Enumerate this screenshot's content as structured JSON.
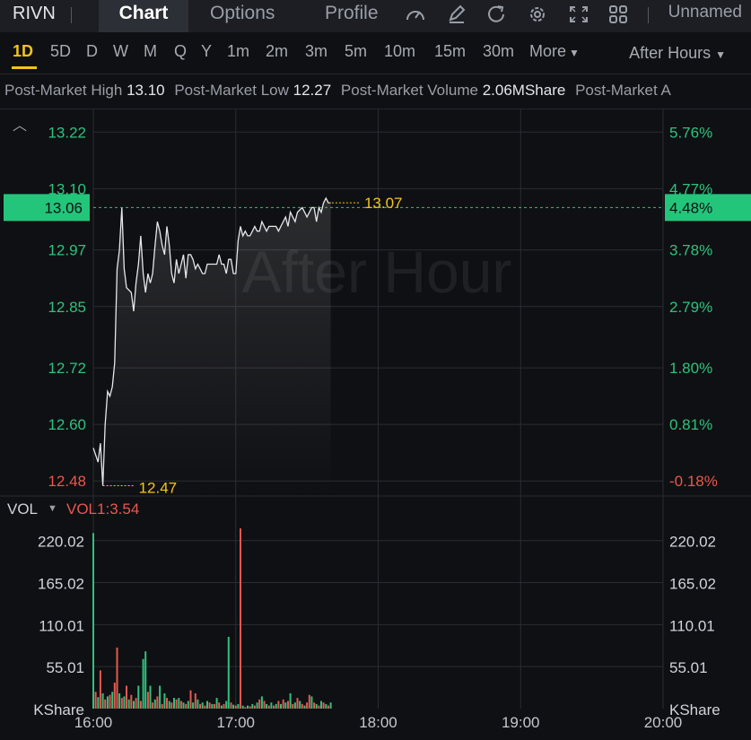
{
  "toolbar": {
    "ticker": "RIVN",
    "tabs": [
      "Chart",
      "Options",
      "Profile"
    ],
    "active_tab": "Chart",
    "layout_name": "Unnamed"
  },
  "timeframes": {
    "items": [
      "1D",
      "5D",
      "D",
      "W",
      "M",
      "Q",
      "Y",
      "1m",
      "2m",
      "3m",
      "5m",
      "10m",
      "15m",
      "30m"
    ],
    "active": "1D",
    "more_label": "More",
    "session_label": "After Hours"
  },
  "info": {
    "high_label": "Post-Market High",
    "high_value": "13.10",
    "low_label": "Post-Market Low",
    "low_value": "12.27",
    "volume_label": "Post-Market Volume",
    "volume_value": "2.06MShare",
    "truncated_label": "Post-Market A"
  },
  "colors": {
    "up": "#2ec27e",
    "down": "#e8574f",
    "current_price_bg": "#23c57a",
    "marker": "#f5c518",
    "line": "#e6e7ea",
    "grid": "#2a2c32"
  },
  "watermark": "After Hour",
  "chart_data": [
    {
      "type": "line",
      "xlim": [
        "16:00",
        "20:00"
      ],
      "x_ticks": [
        "16:00",
        "17:00",
        "18:00",
        "19:00",
        "20:00"
      ],
      "ylim": [
        12.45,
        13.27
      ],
      "y_ticks": [
        13.22,
        13.1,
        12.97,
        12.85,
        12.72,
        12.6,
        12.48
      ],
      "y_tick_labels": [
        "13.22",
        "13.10",
        "12.97",
        "12.85",
        "12.72",
        "12.60",
        "12.48"
      ],
      "right_ticks_pct": [
        "5.76%",
        "4.77%",
        "3.78%",
        "2.79%",
        "1.80%",
        "0.81%",
        "-0.18%"
      ],
      "current_price": "13.06",
      "current_pct": "4.48%",
      "high_marker": {
        "x": "17:39",
        "value": "13.07"
      },
      "low_marker": {
        "x": "16:04",
        "value": "12.47"
      },
      "series": [
        {
          "x": [
            "16:00",
            "16:02",
            "16:03",
            "16:04",
            "16:05",
            "16:06",
            "16:07",
            "16:08",
            "16:09",
            "16:10",
            "16:11",
            "16:12",
            "16:13",
            "16:14",
            "16:16",
            "16:17",
            "16:18",
            "16:19",
            "16:20",
            "16:21",
            "16:22",
            "16:23",
            "16:24",
            "16:25",
            "16:26",
            "16:27",
            "16:28",
            "16:29",
            "16:30",
            "16:31",
            "16:32",
            "16:33",
            "16:34",
            "16:35",
            "16:36",
            "16:37",
            "16:38",
            "16:39",
            "16:40",
            "16:41",
            "16:42",
            "16:43",
            "16:44",
            "16:45",
            "16:46",
            "16:47",
            "16:48",
            "16:50",
            "16:51",
            "16:52",
            "16:53",
            "16:54",
            "16:55",
            "16:56",
            "16:57",
            "16:58",
            "16:59",
            "17:00",
            "17:01",
            "17:02",
            "17:03",
            "17:04",
            "17:05",
            "17:06",
            "17:07",
            "17:08",
            "17:09",
            "17:10",
            "17:11",
            "17:12",
            "17:13",
            "17:14",
            "17:16",
            "17:17",
            "17:18",
            "17:19",
            "17:21",
            "17:22",
            "17:23",
            "17:24",
            "17:25",
            "17:26",
            "17:28",
            "17:29",
            "17:30",
            "17:31",
            "17:32",
            "17:33",
            "17:34",
            "17:35",
            "17:36",
            "17:37",
            "17:38",
            "17:39",
            "17:40"
          ],
          "y": [
            12.55,
            12.52,
            12.56,
            12.47,
            12.6,
            12.67,
            12.66,
            12.68,
            12.73,
            12.93,
            12.97,
            13.06,
            12.93,
            12.89,
            12.88,
            12.84,
            12.9,
            12.94,
            13.0,
            12.92,
            12.88,
            12.92,
            12.9,
            12.92,
            12.98,
            13.03,
            13.01,
            12.98,
            12.96,
            13.02,
            12.98,
            12.92,
            12.9,
            12.95,
            12.92,
            12.94,
            12.96,
            12.91,
            12.96,
            12.96,
            12.95,
            12.93,
            12.94,
            12.93,
            12.92,
            12.92,
            12.94,
            12.94,
            12.94,
            12.94,
            12.96,
            12.94,
            12.94,
            12.92,
            12.95,
            12.95,
            12.92,
            12.92,
            12.99,
            13.02,
            13.0,
            13.01,
            13.0,
            13.0,
            13.01,
            13.02,
            13.01,
            13.01,
            13.03,
            13.02,
            13.01,
            13.02,
            13.02,
            13.02,
            13.01,
            13.02,
            13.04,
            13.02,
            13.05,
            13.04,
            13.03,
            13.05,
            13.06,
            13.05,
            13.04,
            13.05,
            13.06,
            13.06,
            13.03,
            13.06,
            13.05,
            13.07,
            13.08,
            13.07,
            13.07
          ]
        }
      ]
    },
    {
      "type": "bar",
      "title": "VOL",
      "indicator_label": "VOL1:3.54",
      "unit_label": "KShare",
      "ylim": [
        0,
        235
      ],
      "y_ticks": [
        55.01,
        110.01,
        165.02,
        220.02
      ],
      "y_tick_labels": [
        "55.01",
        "110.01",
        "165.02",
        "220.02"
      ],
      "xlim": [
        "16:00",
        "20:00"
      ],
      "x": [
        "16:00",
        "16:01",
        "16:02",
        "16:03",
        "16:04",
        "16:05",
        "16:06",
        "16:07",
        "16:08",
        "16:09",
        "16:10",
        "16:11",
        "16:12",
        "16:13",
        "16:14",
        "16:15",
        "16:16",
        "16:17",
        "16:18",
        "16:19",
        "16:20",
        "16:21",
        "16:22",
        "16:23",
        "16:24",
        "16:25",
        "16:26",
        "16:27",
        "16:28",
        "16:29",
        "16:30",
        "16:31",
        "16:32",
        "16:33",
        "16:34",
        "16:35",
        "16:36",
        "16:37",
        "16:38",
        "16:39",
        "16:40",
        "16:41",
        "16:42",
        "16:43",
        "16:44",
        "16:45",
        "16:46",
        "16:47",
        "16:48",
        "16:49",
        "16:50",
        "16:51",
        "16:52",
        "16:53",
        "16:54",
        "16:55",
        "16:56",
        "16:57",
        "16:58",
        "16:59",
        "17:00",
        "17:01",
        "17:02",
        "17:03",
        "17:04",
        "17:05",
        "17:06",
        "17:07",
        "17:08",
        "17:09",
        "17:10",
        "17:11",
        "17:12",
        "17:13",
        "17:14",
        "17:15",
        "17:16",
        "17:17",
        "17:18",
        "17:19",
        "17:20",
        "17:21",
        "17:22",
        "17:23",
        "17:24",
        "17:25",
        "17:26",
        "17:27",
        "17:28",
        "17:29",
        "17:30",
        "17:31",
        "17:32",
        "17:33",
        "17:34",
        "17:35",
        "17:36",
        "17:37",
        "17:38",
        "17:39",
        "17:40"
      ],
      "values": [
        230,
        22,
        15,
        50,
        20,
        12,
        16,
        18,
        22,
        34,
        80,
        20,
        14,
        16,
        30,
        12,
        18,
        10,
        14,
        30,
        10,
        65,
        75,
        22,
        30,
        8,
        12,
        16,
        30,
        6,
        20,
        14,
        10,
        8,
        14,
        12,
        14,
        10,
        8,
        6,
        10,
        24,
        8,
        20,
        12,
        6,
        8,
        4,
        10,
        8,
        6,
        6,
        14,
        8,
        4,
        6,
        10,
        94,
        8,
        5,
        4,
        6,
        236,
        4,
        2,
        4,
        3,
        6,
        4,
        8,
        12,
        16,
        10,
        6,
        4,
        8,
        4,
        6,
        10,
        6,
        12,
        8,
        10,
        20,
        6,
        8,
        14,
        10,
        6,
        4,
        8,
        18,
        16,
        8,
        6,
        4,
        10,
        8,
        6,
        4,
        8
      ],
      "directions": [
        "up",
        "down",
        "up",
        "down",
        "up",
        "down",
        "up",
        "down",
        "up",
        "down",
        "down",
        "up",
        "down",
        "up",
        "down",
        "up",
        "down",
        "up",
        "down",
        "up",
        "down",
        "up",
        "up",
        "down",
        "up",
        "down",
        "up",
        "down",
        "up",
        "down",
        "up",
        "down",
        "up",
        "down",
        "up",
        "down",
        "up",
        "down",
        "up",
        "down",
        "up",
        "down",
        "up",
        "down",
        "up",
        "down",
        "up",
        "down",
        "up",
        "down",
        "up",
        "down",
        "up",
        "down",
        "up",
        "down",
        "up",
        "up",
        "down",
        "up",
        "down",
        "up",
        "down",
        "up",
        "down",
        "up",
        "down",
        "up",
        "down",
        "up",
        "down",
        "up",
        "down",
        "up",
        "down",
        "up",
        "down",
        "up",
        "down",
        "up",
        "down",
        "up",
        "down",
        "up",
        "down",
        "up",
        "down",
        "up",
        "down",
        "up",
        "down",
        "down",
        "up",
        "down",
        "up",
        "down",
        "up",
        "down",
        "up",
        "down",
        "up"
      ]
    }
  ]
}
